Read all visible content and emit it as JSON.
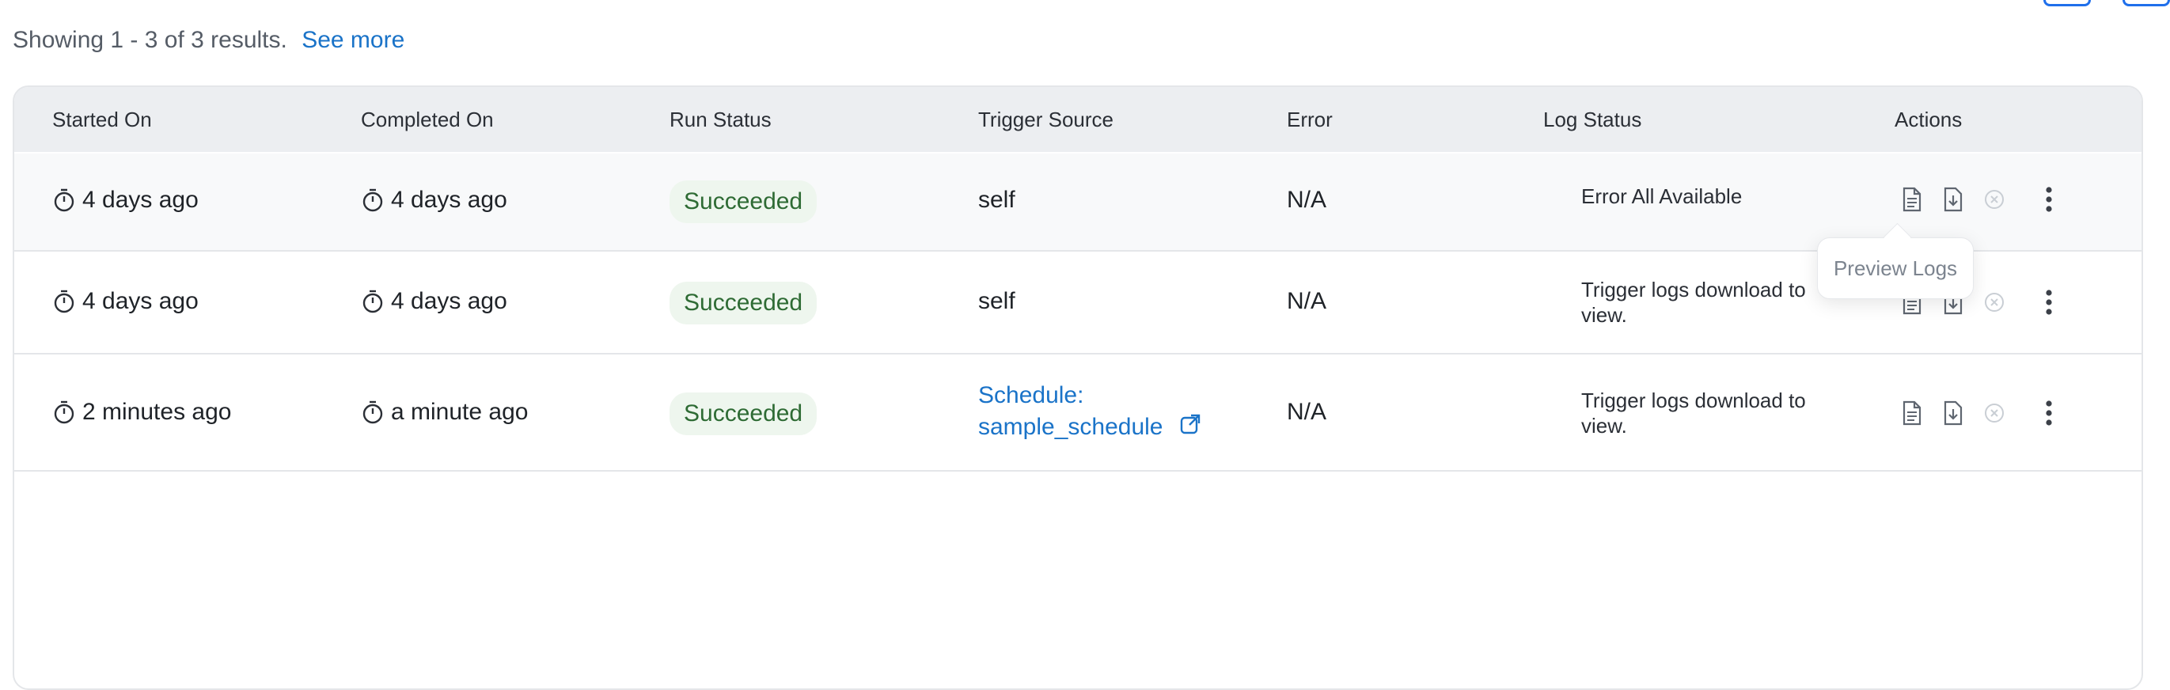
{
  "results": {
    "summary": "Showing 1 - 3 of 3 results.",
    "see_more": "See more"
  },
  "table": {
    "headers": [
      "Started On",
      "Completed On",
      "Run Status",
      "Trigger Source",
      "Error",
      "Log Status",
      "Actions"
    ],
    "rows": [
      {
        "started_on": "4 days ago",
        "completed_on": "4 days ago",
        "run_status": "Succeeded",
        "trigger_source": "self",
        "error": "N/A",
        "log_status": "Error All Available"
      },
      {
        "started_on": "4 days ago",
        "completed_on": "4 days ago",
        "run_status": "Succeeded",
        "trigger_source": "self",
        "error": "N/A",
        "log_status": "Trigger logs download to view."
      },
      {
        "started_on": "2 minutes ago",
        "completed_on": "a minute ago",
        "run_status": "Succeeded",
        "trigger_source_link": "Schedule: sample_schedule",
        "error": "N/A",
        "log_status": "Trigger logs download to view."
      }
    ]
  },
  "tooltip": {
    "text": "Preview Logs"
  },
  "icons": {
    "clock": "stopwatch-icon",
    "preview": "document-icon",
    "download": "download-icon",
    "cancel": "cancel-circle-icon",
    "more": "kebab-menu-icon",
    "external": "external-link-icon"
  },
  "colors": {
    "link": "#1a73c8",
    "success_bg": "#eef6ee",
    "success_text": "#2e6b34",
    "header_bg": "#eceef1"
  }
}
